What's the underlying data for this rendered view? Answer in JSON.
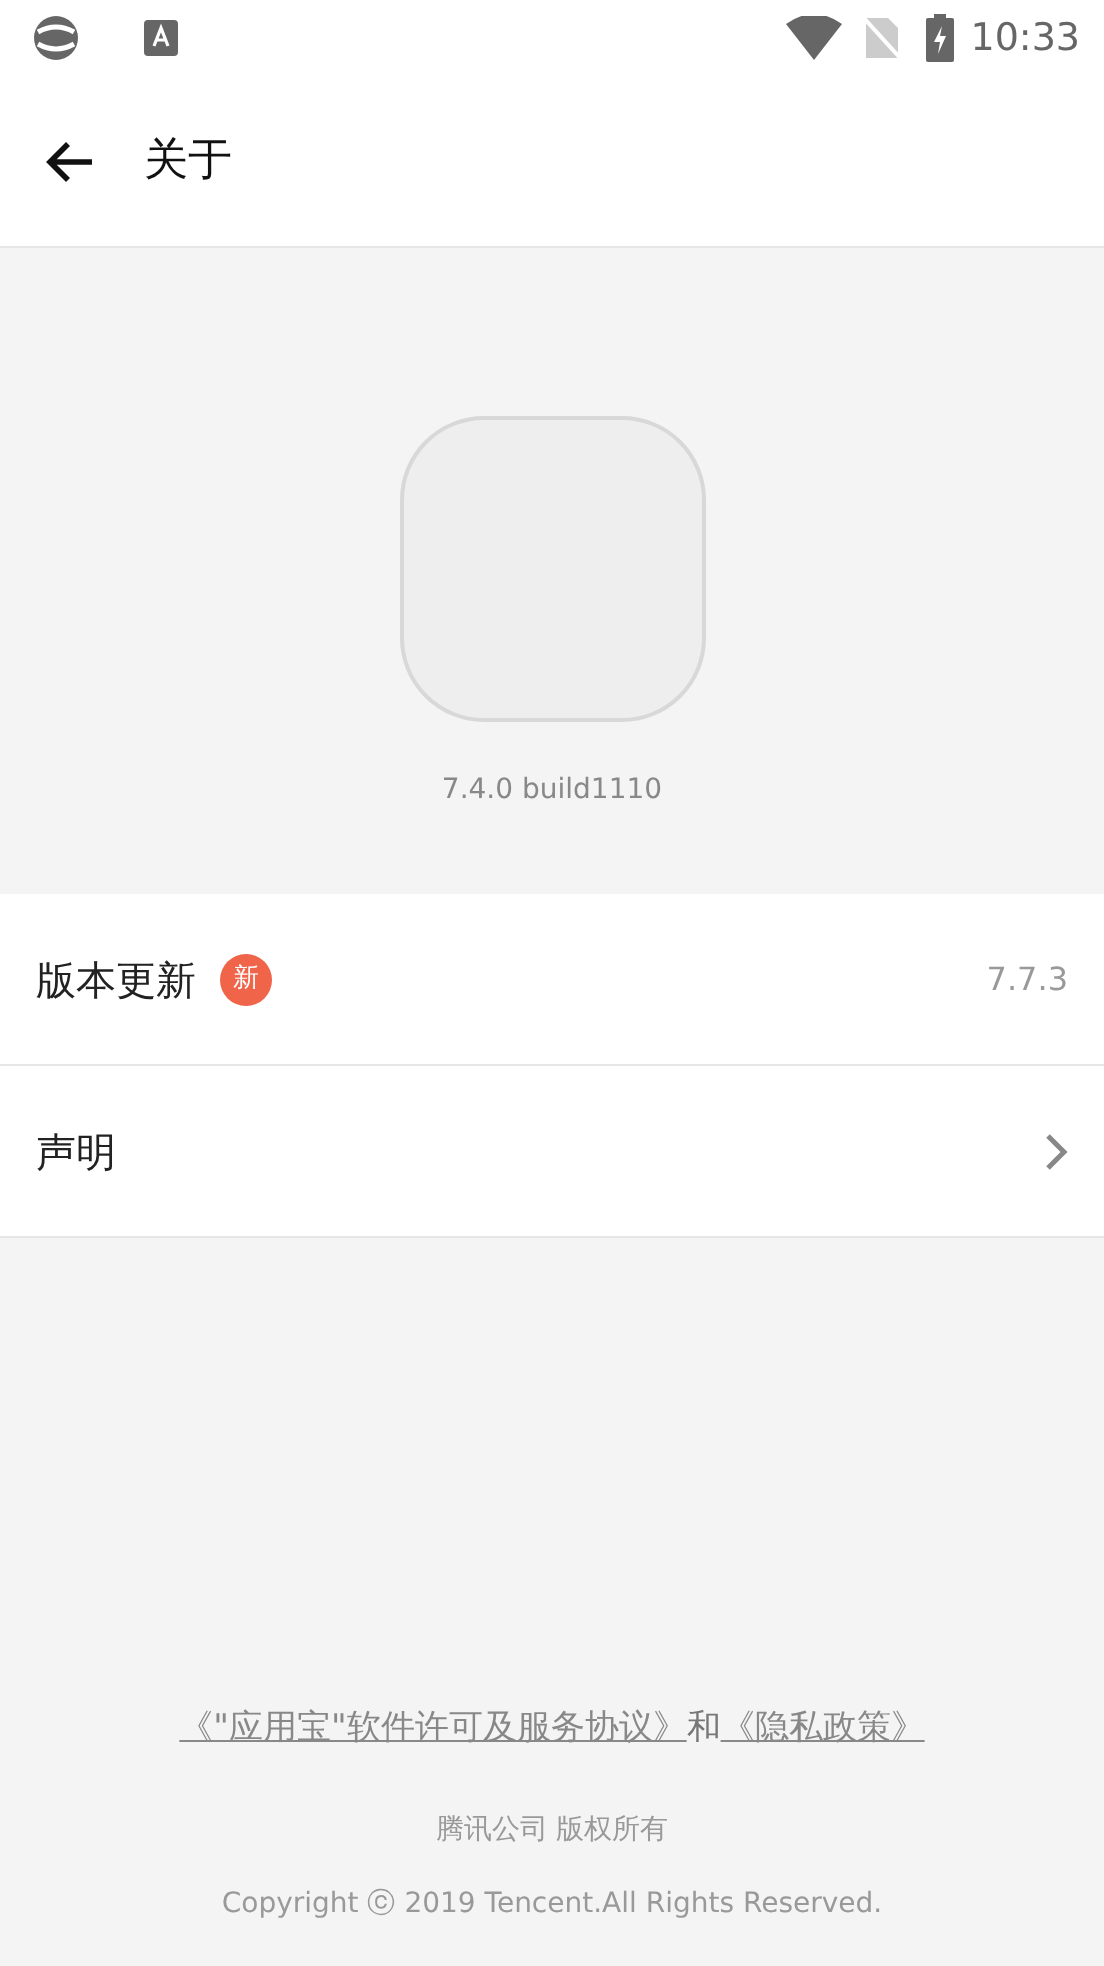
{
  "status_bar": {
    "time": "10:33"
  },
  "header": {
    "title": "关于"
  },
  "app": {
    "version": "7.4.0 build1110"
  },
  "rows": [
    {
      "kind": "update",
      "label": "版本更新",
      "badge": "新",
      "value": "7.7.3"
    },
    {
      "kind": "link",
      "label": "声明"
    }
  ],
  "footer": {
    "links": [
      {
        "text": "《\"应用宝\"软件许可及服务协议》"
      },
      {
        "text": "《隐私政策》"
      }
    ],
    "joiner": "和",
    "owner": "腾讯公司 版权所有",
    "copyright": "Copyright ⓒ 2019 Tencent.All Rights Reserved."
  }
}
